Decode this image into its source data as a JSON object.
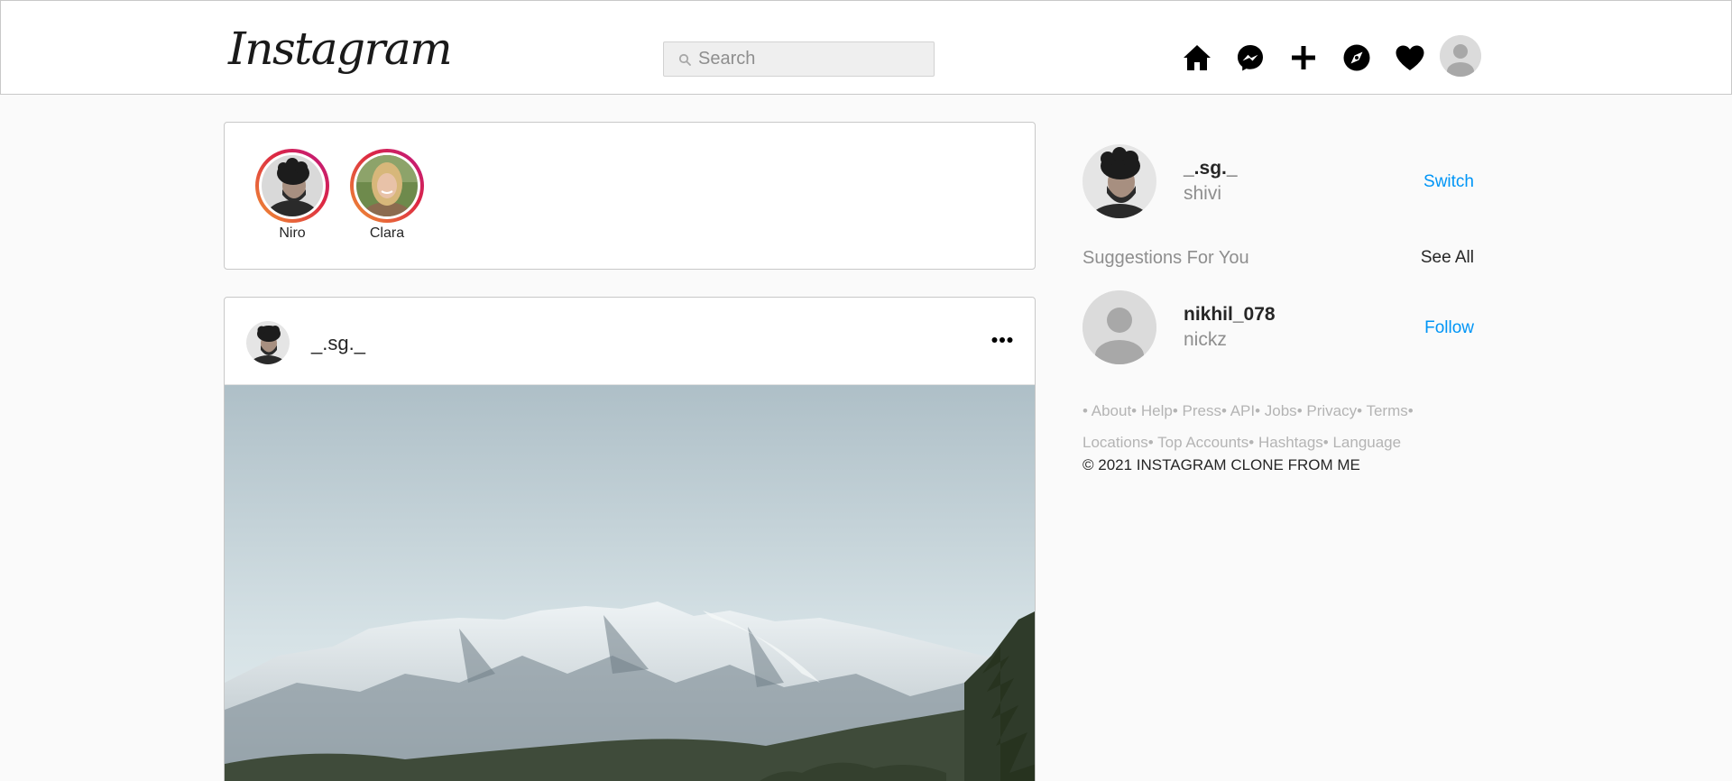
{
  "header": {
    "logo": "Instagram",
    "search_placeholder": "Search"
  },
  "icons": {
    "home": "home-icon",
    "messenger": "messenger-icon",
    "new_post": "plus-icon",
    "explore": "compass-icon",
    "activity": "heart-icon",
    "profile": "avatar"
  },
  "stories": [
    {
      "name": "Niro"
    },
    {
      "name": "Clara"
    }
  ],
  "post": {
    "username": "_.sg._"
  },
  "sidebar": {
    "username": "_.sg._",
    "name": "shivi",
    "switch_label": "Switch",
    "suggestions_title": "Suggestions For You",
    "see_all_label": "See All",
    "suggestions": [
      {
        "username": "nikhil_078",
        "name": "nickz",
        "action": "Follow"
      }
    ],
    "footer_links": [
      "• About",
      "• Help",
      "• Press",
      "• API",
      "• Jobs",
      "• Privacy",
      "• Terms",
      "•",
      "Locations",
      "• Top Accounts",
      "• Hashtags",
      "• Language"
    ],
    "copyright": "© 2021 INSTAGRAM CLONE FROM ME"
  },
  "colors": {
    "link_blue": "#0095f6",
    "story_gradient": [
      "#f09433",
      "#dc2743",
      "#bc1888"
    ],
    "background": "#fafafa"
  }
}
